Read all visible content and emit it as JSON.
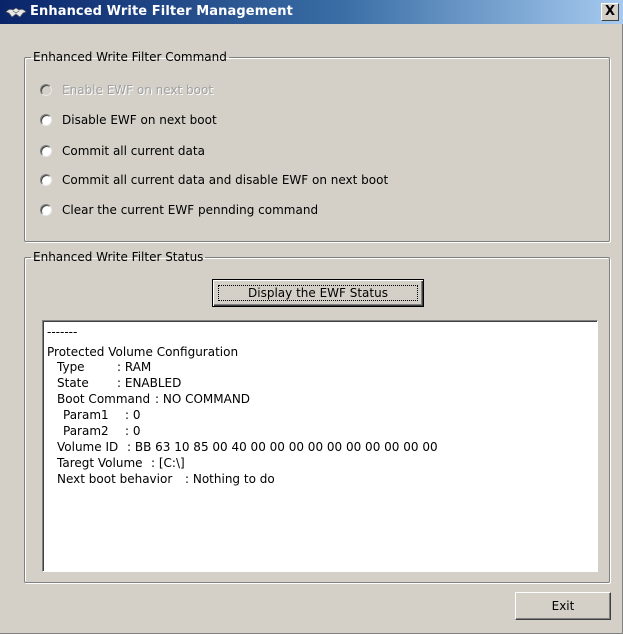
{
  "window": {
    "title": "Enhanced Write Filter Management",
    "close_label": "X",
    "icon": "ewf-app-icon"
  },
  "command_group": {
    "title": "Enhanced Write Filter Command",
    "options": [
      {
        "label": "Enable EWF on next boot",
        "disabled": true
      },
      {
        "label": "Disable EWF on next boot",
        "disabled": false
      },
      {
        "label": "Commit all current data",
        "disabled": false
      },
      {
        "label": "Commit all current data and disable EWF on next boot",
        "disabled": false
      },
      {
        "label": "Clear the current EWF pennding command",
        "disabled": false
      }
    ]
  },
  "status_group": {
    "title": "Enhanced Write Filter Status",
    "display_button_label": "Display the EWF Status",
    "output": {
      "separator": "-------",
      "heading": "Protected Volume Configuration",
      "fields": [
        {
          "key": "Type",
          "value": ": RAM"
        },
        {
          "key": "State",
          "value": ": ENABLED"
        },
        {
          "key": "Boot Command",
          "value": ": NO COMMAND"
        },
        {
          "key": "Param1",
          "value": ": 0"
        },
        {
          "key": "Param2",
          "value": ": 0"
        },
        {
          "key": "Volume ID",
          "value": ": BB 63 10 85 00 40 00 00 00 00 00 00 00 00 00 00"
        },
        {
          "key": "Taregt Volume",
          "value": ": [C:\\]"
        },
        {
          "key": "Next boot behavior",
          "value": ": Nothing to do"
        }
      ]
    }
  },
  "footer": {
    "exit_label": "Exit"
  }
}
